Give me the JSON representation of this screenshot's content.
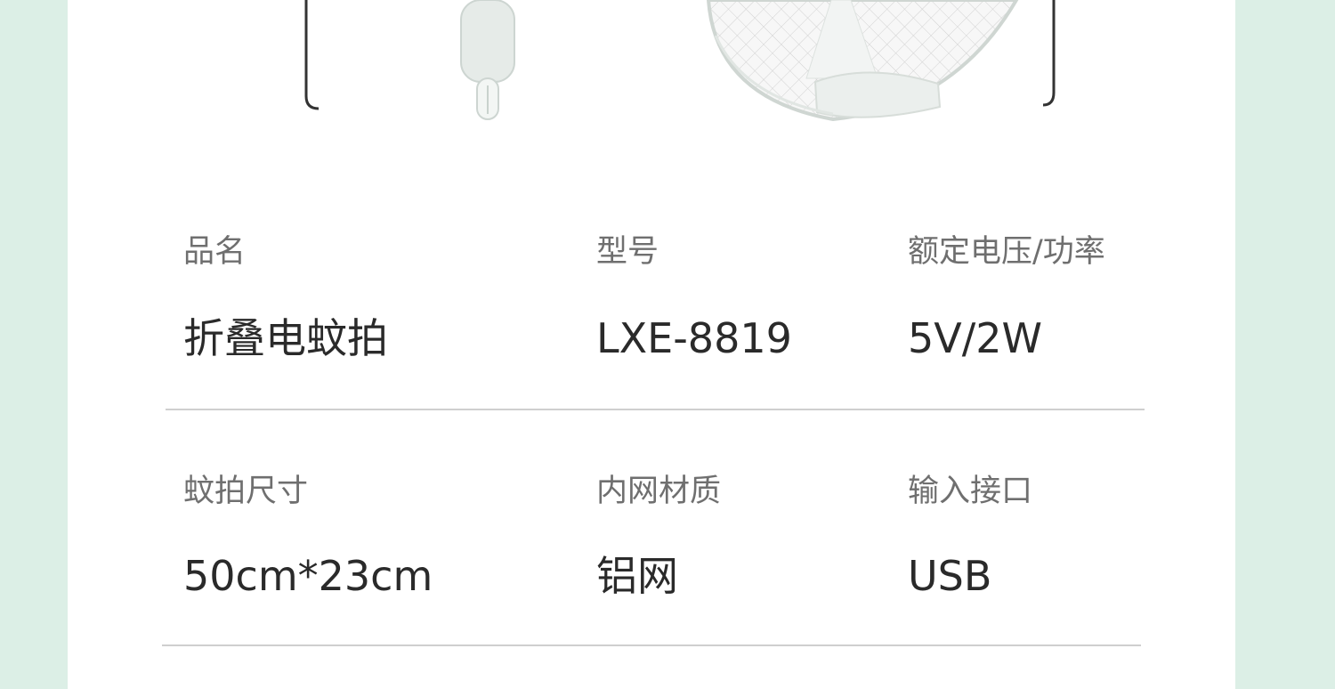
{
  "specs": [
    {
      "label": "品名",
      "value": "折叠电蚊拍"
    },
    {
      "label": "型号",
      "value": "LXE-8819"
    },
    {
      "label": "额定电压/功率",
      "value": "5V/2W"
    },
    {
      "label": "蚊拍尺寸",
      "value": "50cm*23cm"
    },
    {
      "label": "内网材质",
      "value": "铝网"
    },
    {
      "label": "输入接口",
      "value": "USB"
    }
  ],
  "colors": {
    "page_background": "#dcefe6",
    "card_background": "#ffffff",
    "label_text": "#6f6f6f",
    "value_text": "#2a2a2a",
    "divider": "#cfcfcf"
  },
  "icons": [
    "folding-mosquito-swatter-illustration"
  ]
}
